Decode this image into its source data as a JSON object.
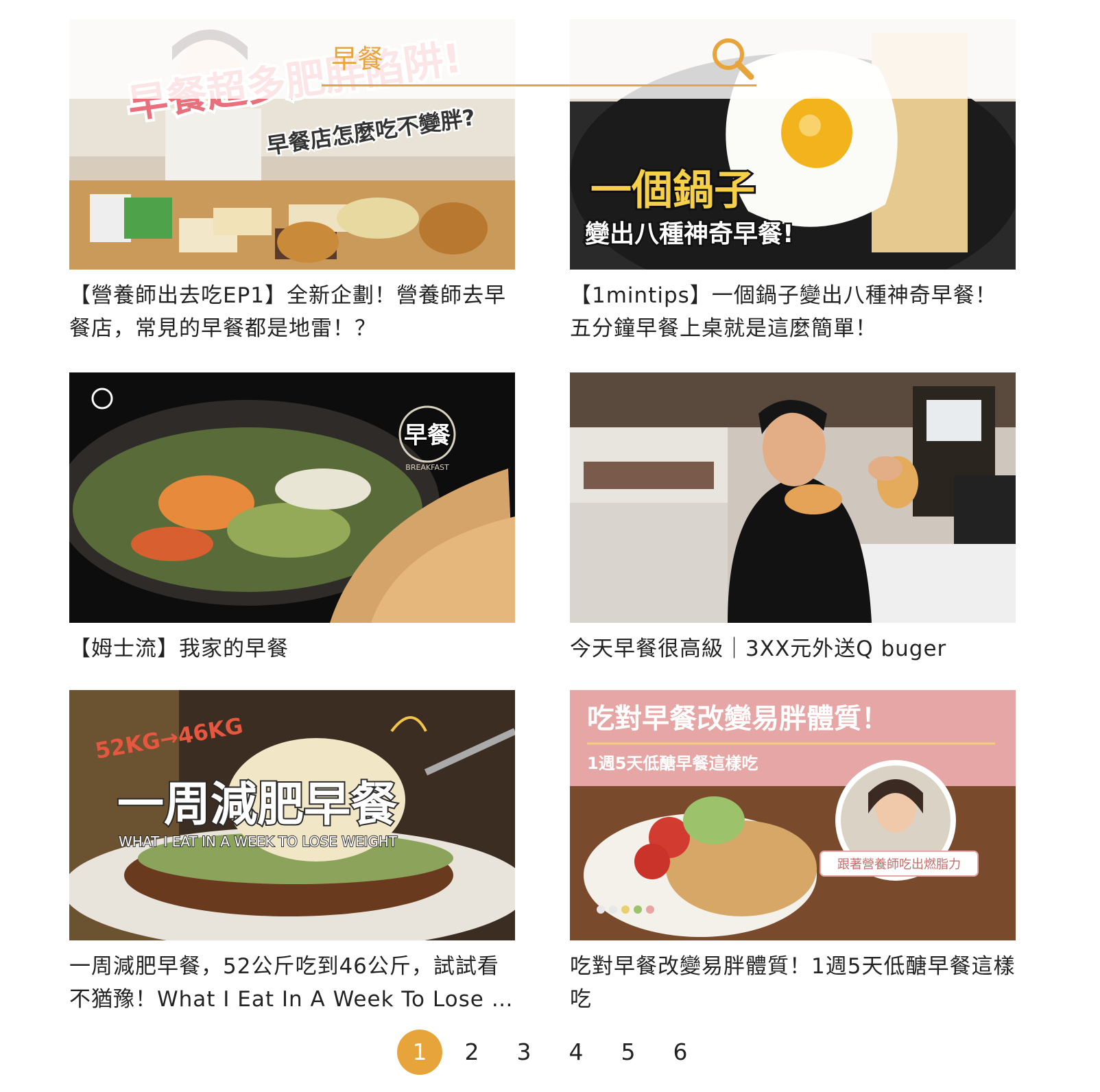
{
  "search": {
    "value": "早餐",
    "placeholder": ""
  },
  "videos": [
    {
      "title": "【營養師出去吃EP1】全新企劃！營養師去早餐店，常見的早餐都是地雷！？",
      "thumb_text": [
        "早餐超多肥胖陷阱!",
        "早餐店怎麼吃不變胖?"
      ]
    },
    {
      "title": "【1mintips】一個鍋子變出八種神奇早餐！ 五分鐘早餐上桌就是這麼簡單！",
      "thumb_text": [
        "一個鍋子",
        "變出八種神奇早餐!"
      ]
    },
    {
      "title": "【姆士流】我家的早餐",
      "thumb_text": [
        "早餐",
        "BREAKFAST"
      ]
    },
    {
      "title": "今天早餐很高級｜3XX元外送Q buger",
      "thumb_text": []
    },
    {
      "title": "一周減肥早餐，52公斤吃到46公斤，試試看不猶豫！What I Eat In A Week To Lose Weight",
      "thumb_text": [
        "52KG→46KG",
        "一周減肥早餐",
        "WHAT I EAT IN A WEEK TO LOSE WEIGHT"
      ]
    },
    {
      "title": "吃對早餐改變易胖體質！1週5天低醣早餐這樣吃",
      "thumb_text": [
        "吃對早餐改變易胖體質！",
        "1週5天低醣早餐這樣吃",
        "跟著營養師吃出燃脂力"
      ]
    }
  ],
  "pagination": {
    "pages": [
      "1",
      "2",
      "3",
      "4",
      "5",
      "6"
    ],
    "current": "1"
  },
  "colors": {
    "accent": "#e6a43b"
  }
}
